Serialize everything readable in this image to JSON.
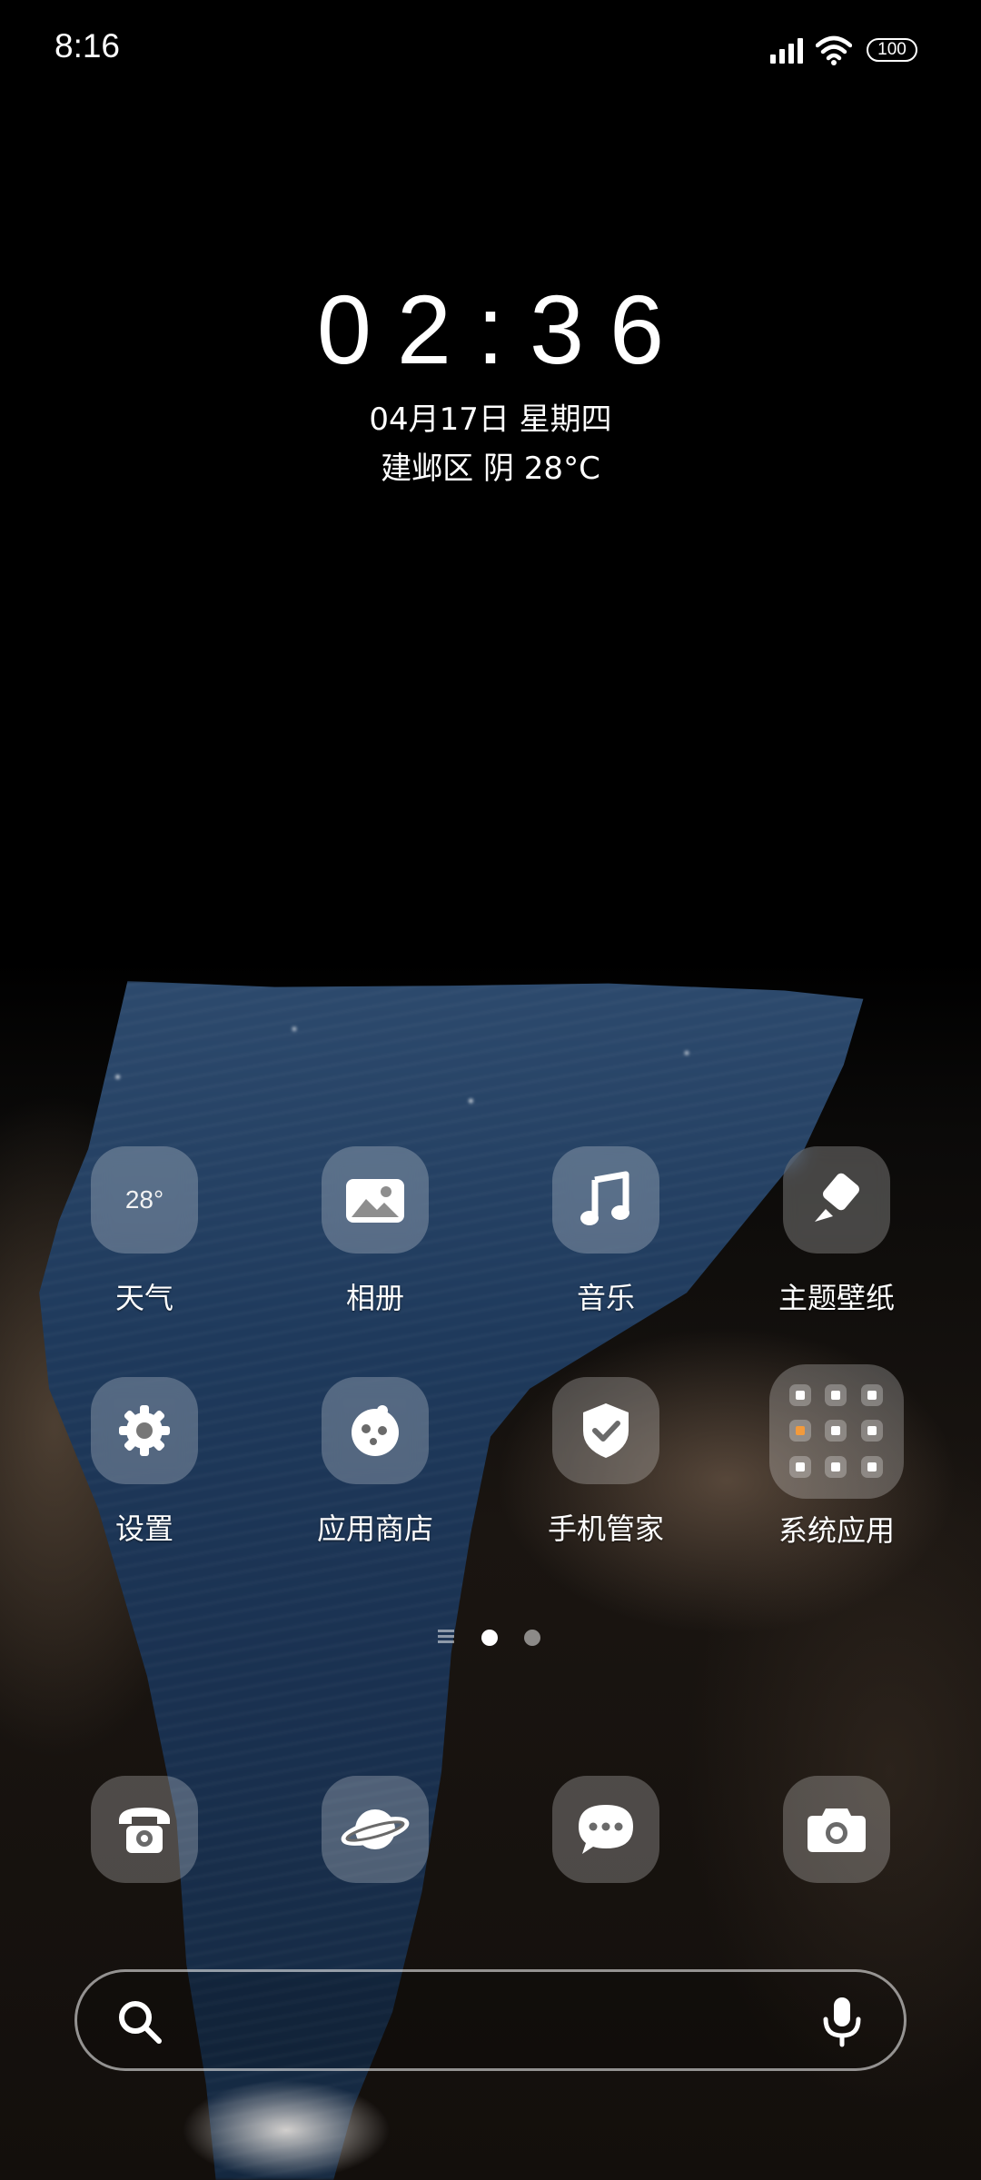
{
  "status_bar": {
    "time": "8:16",
    "battery": "100",
    "icons": [
      "signal-icon",
      "wifi-icon",
      "battery-icon"
    ]
  },
  "clock_widget": {
    "time": "02:36",
    "date": "04月17日 星期四",
    "weather": "建邺区 阴 28°C"
  },
  "apps": [
    {
      "label": "天气",
      "icon": "weather-icon",
      "icon_text": "28°"
    },
    {
      "label": "相册",
      "icon": "gallery-icon"
    },
    {
      "label": "音乐",
      "icon": "music-icon"
    },
    {
      "label": "主题壁纸",
      "icon": "theme-brush-icon"
    },
    {
      "label": "设置",
      "icon": "gear-icon"
    },
    {
      "label": "应用商店",
      "icon": "app-store-icon"
    },
    {
      "label": "手机管家",
      "icon": "shield-check-icon"
    },
    {
      "label": "系统应用",
      "icon": "folder-icon"
    }
  ],
  "dock": [
    {
      "icon": "phone-icon"
    },
    {
      "icon": "browser-planet-icon"
    },
    {
      "icon": "message-icon"
    },
    {
      "icon": "camera-icon"
    }
  ],
  "page_indicator": {
    "pages": 2,
    "active": 1
  },
  "search": {
    "placeholder": ""
  },
  "colors": {
    "background": "#000000",
    "icon_bg": "rgba(255,255,255,0.24)",
    "text": "#ffffff"
  }
}
